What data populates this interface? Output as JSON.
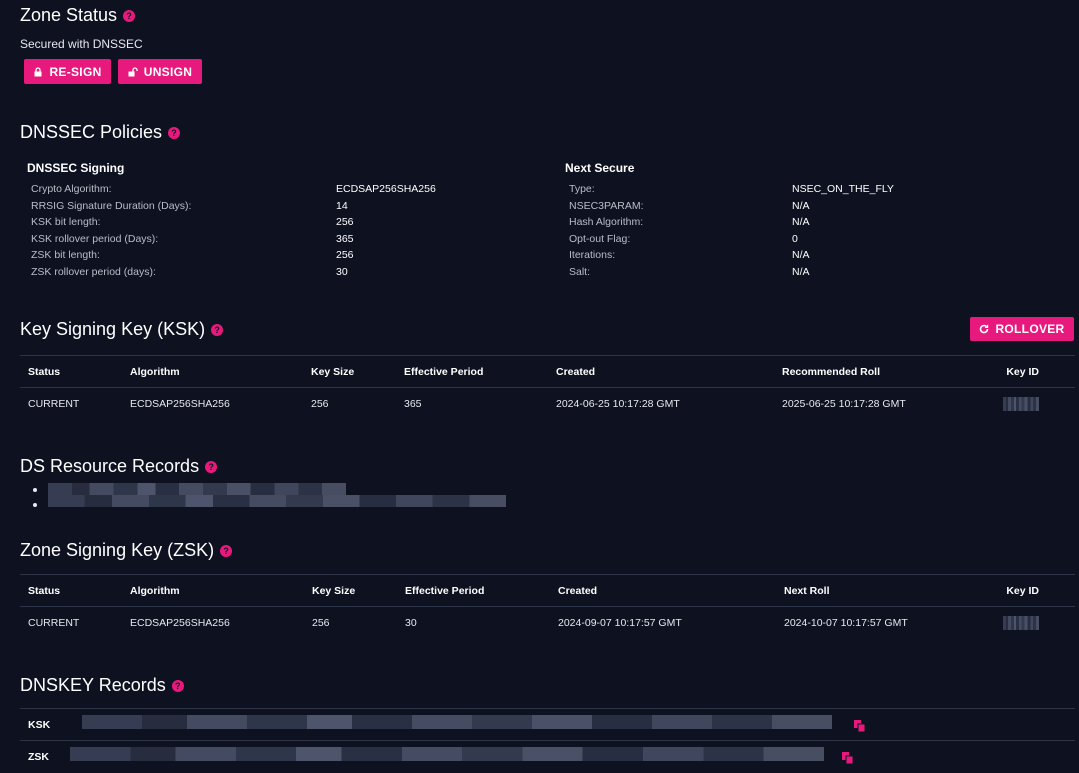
{
  "zone_status": {
    "title": "Zone Status",
    "subtitle": "Secured with DNSSEC",
    "resign_label": "RE-SIGN",
    "unsign_label": "UNSIGN"
  },
  "policies": {
    "title": "DNSSEC Policies",
    "signing": {
      "title": "DNSSEC Signing",
      "rows": [
        {
          "k": "Crypto Algorithm:",
          "v": "ECDSAP256SHA256"
        },
        {
          "k": "RRSIG Signature Duration (Days):",
          "v": "14"
        },
        {
          "k": "KSK bit length:",
          "v": "256"
        },
        {
          "k": "KSK rollover period (Days):",
          "v": "365"
        },
        {
          "k": "ZSK bit length:",
          "v": "256"
        },
        {
          "k": "ZSK rollover period (days):",
          "v": "30"
        }
      ]
    },
    "next_secure": {
      "title": "Next Secure",
      "rows": [
        {
          "k": "Type:",
          "v": "NSEC_ON_THE_FLY"
        },
        {
          "k": "NSEC3PARAM:",
          "v": "N/A"
        },
        {
          "k": "Hash Algorithm:",
          "v": "N/A"
        },
        {
          "k": "Opt-out Flag:",
          "v": "0"
        },
        {
          "k": "Iterations:",
          "v": "N/A"
        },
        {
          "k": "Salt:",
          "v": "N/A"
        }
      ]
    }
  },
  "ksk": {
    "title": "Key Signing Key (KSK)",
    "rollover_label": "ROLLOVER",
    "headers": [
      "Status",
      "Algorithm",
      "Key Size",
      "Effective Period",
      "Created",
      "Recommended Roll",
      "Key ID"
    ],
    "row": [
      "CURRENT",
      "ECDSAP256SHA256",
      "256",
      "365",
      "2024-06-25 10:17:28 GMT",
      "2025-06-25 10:17:28 GMT"
    ]
  },
  "ds": {
    "title": "DS Resource Records"
  },
  "zsk": {
    "title": "Zone Signing Key (ZSK)",
    "headers": [
      "Status",
      "Algorithm",
      "Key Size",
      "Effective Period",
      "Created",
      "Next Roll",
      "Key ID"
    ],
    "row": [
      "CURRENT",
      "ECDSAP256SHA256",
      "256",
      "30",
      "2024-09-07 10:17:57 GMT",
      "2024-10-07 10:17:57 GMT"
    ]
  },
  "dnskey": {
    "title": "DNSKEY Records",
    "rows": [
      {
        "label": "KSK"
      },
      {
        "label": "ZSK"
      }
    ]
  },
  "colors": {
    "accent": "#e8197d",
    "background": "#0e1220"
  },
  "icons": [
    "help-icon",
    "lock-icon",
    "unlock-icon",
    "refresh-icon",
    "copy-icon"
  ]
}
